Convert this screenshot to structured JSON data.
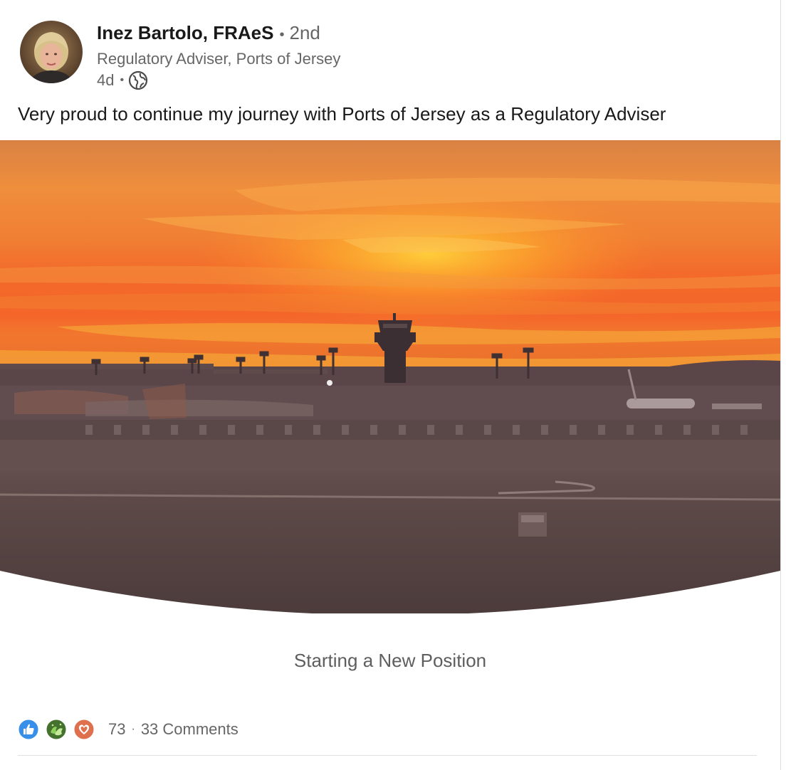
{
  "post": {
    "author": {
      "name": "Inez Bartolo, FRAeS",
      "connection_separator": "•",
      "connection_degree": "2nd",
      "headline": "Regulatory Adviser, Ports of Jersey"
    },
    "meta": {
      "time_ago": "4d",
      "separator": "•",
      "visibility_icon": "globe-icon"
    },
    "text": "Very proud to continue my journey with Ports of Jersey as a Regulatory Adviser",
    "image": {
      "subject": "sunset-airport-control-tower"
    },
    "caption": "Starting a New Position",
    "social": {
      "reaction_icons": [
        "like-icon",
        "celebrate-icon",
        "love-icon"
      ],
      "reaction_count": "73",
      "separator": "·",
      "comments": "33 Comments"
    }
  },
  "colors": {
    "text_primary": "#191919",
    "text_secondary": "#666666",
    "like_blue": "#378fe9",
    "celebrate_green": "#44712e",
    "love_red": "#df704d",
    "sunset_orange": "#f2682a"
  }
}
